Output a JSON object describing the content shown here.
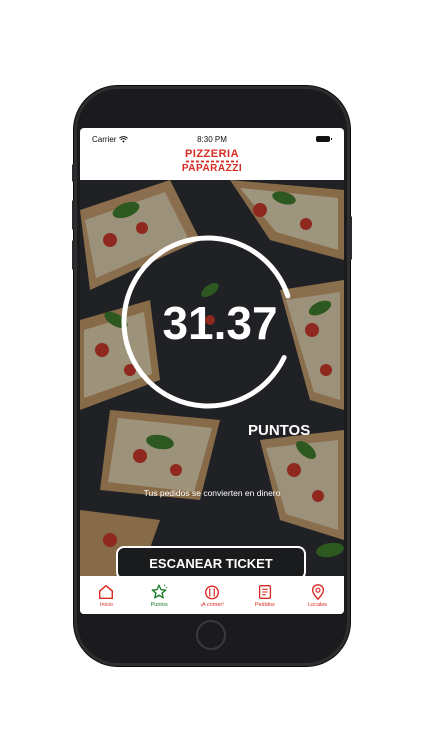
{
  "status_bar": {
    "carrier": "Carrier",
    "time": "8:30 PM"
  },
  "brand": {
    "line1": "PIZZERIA",
    "line2": "PAPARAZZI",
    "color": "#d82a20"
  },
  "points": {
    "value": "31.37",
    "label": "PUNTOS",
    "ring_fill": 0.88
  },
  "subtitle": "Tus pedidos se convierten en dinero",
  "scan_button": {
    "label": "ESCANEAR TICKET"
  },
  "tabs": [
    {
      "label": "Inicio",
      "icon": "home-icon",
      "active": false
    },
    {
      "label": "Puntos",
      "icon": "star-icon",
      "active": true
    },
    {
      "label": "¡A comer!",
      "icon": "plate-icon",
      "active": false
    },
    {
      "label": "Pedidos",
      "icon": "receipt-icon",
      "active": false
    },
    {
      "label": "Locales",
      "icon": "location-pin-icon",
      "active": false
    }
  ],
  "colors": {
    "accent": "#d82a20",
    "active_tab": "#1a7a2a"
  }
}
